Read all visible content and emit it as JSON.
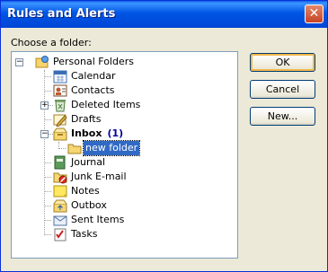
{
  "window": {
    "title": "Rules and Alerts",
    "close_glyph": "✕"
  },
  "prompt_label": "Choose a folder:",
  "tree": {
    "root": "Personal Folders",
    "items": [
      {
        "label": "Calendar",
        "icon": "calendar-icon"
      },
      {
        "label": "Contacts",
        "icon": "contacts-icon"
      },
      {
        "label": "Deleted Items",
        "icon": "deleted-items-icon",
        "expander": "+"
      },
      {
        "label": "Drafts",
        "icon": "drafts-icon"
      },
      {
        "label": "Inbox",
        "icon": "inbox-icon",
        "expander": "−",
        "count": "(1)"
      },
      {
        "label": "new folder",
        "icon": "folder-icon",
        "selected": true
      },
      {
        "label": "Journal",
        "icon": "journal-icon"
      },
      {
        "label": "Junk E-mail",
        "icon": "junk-email-icon"
      },
      {
        "label": "Notes",
        "icon": "notes-icon"
      },
      {
        "label": "Outbox",
        "icon": "outbox-icon"
      },
      {
        "label": "Sent Items",
        "icon": "sent-items-icon"
      },
      {
        "label": "Tasks",
        "icon": "tasks-icon"
      }
    ],
    "root_expander": "−"
  },
  "buttons": {
    "ok": "OK",
    "cancel": "Cancel",
    "new": "New..."
  }
}
